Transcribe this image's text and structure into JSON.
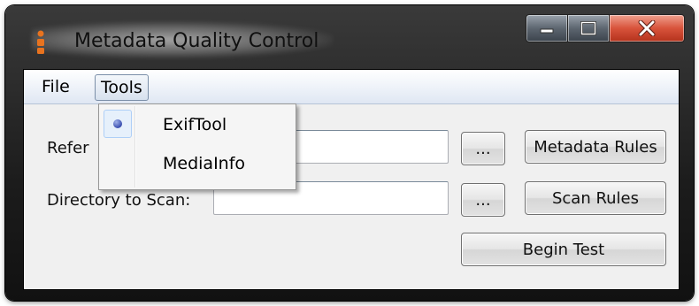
{
  "window": {
    "title": "Metadata Quality Control"
  },
  "menubar": {
    "file": "File",
    "tools": "Tools"
  },
  "tools_menu": {
    "items": [
      {
        "label": "ExifTool",
        "selected": true
      },
      {
        "label": "MediaInfo",
        "selected": false
      }
    ]
  },
  "form": {
    "reference_label": "Refer",
    "reference_value": "",
    "directory_label": "Directory to Scan:",
    "directory_value": "",
    "browse_reference": "...",
    "browse_directory": "...",
    "metadata_rules": "Metadata Rules",
    "scan_rules": "Scan Rules",
    "begin_test": "Begin Test"
  },
  "colors": {
    "accent_close": "#d8533b",
    "app_icon": "#e8731f"
  },
  "icons": [
    "app-icon",
    "minimize-icon",
    "maximize-icon",
    "close-icon",
    "radio-check-icon"
  ]
}
